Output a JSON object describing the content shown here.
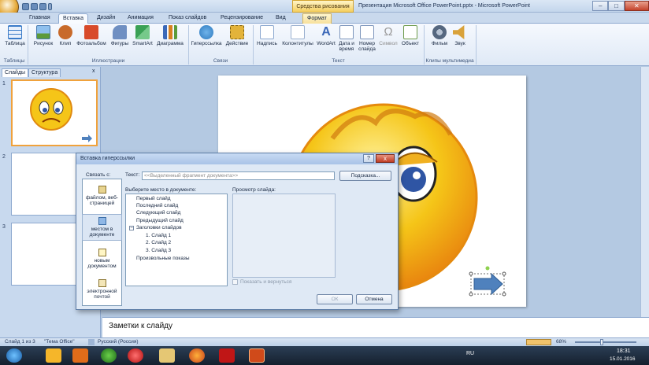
{
  "titlebar": {
    "contextual_tab": "Средства рисования",
    "title": "Презентация Microsoft Office PowerPoint.pptx - Microsoft PowerPoint",
    "minimize": "–",
    "restore": "□",
    "close": "✕"
  },
  "tabs": [
    {
      "label": "Главная"
    },
    {
      "label": "Вставка"
    },
    {
      "label": "Дизайн"
    },
    {
      "label": "Анимация"
    },
    {
      "label": "Показ слайдов"
    },
    {
      "label": "Рецензирование"
    },
    {
      "label": "Вид"
    },
    {
      "label": "Формат"
    }
  ],
  "ribbon": {
    "buttons": [
      {
        "label": "Таблица",
        "icon": "table-icon",
        "color": "#3a7bc8"
      },
      {
        "label": "Рисунок",
        "icon": "picture-icon",
        "color": "#5b9bd5"
      },
      {
        "label": "Клип",
        "icon": "clip-icon",
        "color": "#c86a2a"
      },
      {
        "label": "Фотоальбом",
        "icon": "photo-album-icon",
        "color": "#d84a2a"
      },
      {
        "label": "Фигуры",
        "icon": "shapes-icon",
        "color": "#6f8fc2"
      },
      {
        "label": "SmartArt",
        "icon": "smartart-icon",
        "color": "#3aa155"
      },
      {
        "label": "Диаграмма",
        "icon": "chart-icon",
        "color": "#d8801f"
      },
      {
        "label": "Гиперссылка",
        "icon": "hyperlink-icon",
        "color": "#2e7abf"
      },
      {
        "label": "Действие",
        "icon": "action-icon",
        "color": "#e3b33a"
      },
      {
        "label": "Надпись",
        "icon": "textbox-icon",
        "color": "#8aa7cf"
      },
      {
        "label": "Колонтитулы",
        "icon": "header-footer-icon",
        "color": "#9ab0cf"
      },
      {
        "label": "WordArt",
        "icon": "wordart-icon",
        "color": "#3b68b8"
      },
      {
        "label": "Дата и время",
        "icon": "datetime-icon",
        "color": "#7c95bb"
      },
      {
        "label": "Номер слайда",
        "icon": "slide-number-icon",
        "color": "#7c95bb"
      },
      {
        "label": "Символ",
        "icon": "symbol-icon",
        "color": "#9a9a9a"
      },
      {
        "label": "Объект",
        "icon": "object-icon",
        "color": "#6c9a4a"
      },
      {
        "label": "Фильм",
        "icon": "movie-icon",
        "color": "#55677f"
      },
      {
        "label": "Звук",
        "icon": "sound-icon",
        "color": "#d9a23a"
      }
    ],
    "groups": [
      "Таблицы",
      "Иллюстрации",
      "Связи",
      "Текст",
      "Клипы мультимедиа"
    ]
  },
  "slides_pane": {
    "tabs": [
      "Слайды",
      "Структура"
    ],
    "close": "x",
    "slides": [
      {
        "number": "1"
      },
      {
        "number": "2"
      },
      {
        "number": "3"
      }
    ]
  },
  "notes": {
    "placeholder": "Заметки к слайду"
  },
  "status": {
    "slide": "Слайд 1 из 3",
    "theme": "\"Тема Office\"",
    "language": "Русский (Россия)",
    "zoom": "68%"
  },
  "dialog": {
    "title": "Вставка гиперссылки",
    "help": "?",
    "close": "x",
    "link_to_label": "Связать с:",
    "link_options": [
      {
        "label": "файлом, веб-страницей",
        "icon": "web-page-icon"
      },
      {
        "label": "местом в документе",
        "icon": "place-in-document-icon"
      },
      {
        "label": "новым документом",
        "icon": "new-document-icon"
      },
      {
        "label": "электронной почтой",
        "icon": "email-icon"
      }
    ],
    "text_label": "Текст:",
    "text_value": "<<Выделенный фрагмент документа>>",
    "tooltip_button": "Подсказка...",
    "place_label": "Выберите место в документе:",
    "tree": [
      "Первый слайд",
      "Последний слайд",
      "Следующий слайд",
      "Предыдущий слайд",
      "Заголовки слайдов",
      "1. Слайд 1",
      "2. Слайд 2",
      "3. Слайд 3",
      "Произвольные показы"
    ],
    "preview_label": "Просмотр слайда:",
    "show_return_label": "Показать и вернуться",
    "ok_button": "ОК",
    "cancel_button": "Отмена"
  },
  "taskbar": {
    "lang": "RU",
    "time": "18:31",
    "date": "15.01.2016"
  },
  "colors": {
    "smiley": "#f5c518",
    "smiley_edge": "#e08a10",
    "arrow": "#4f81bd"
  }
}
